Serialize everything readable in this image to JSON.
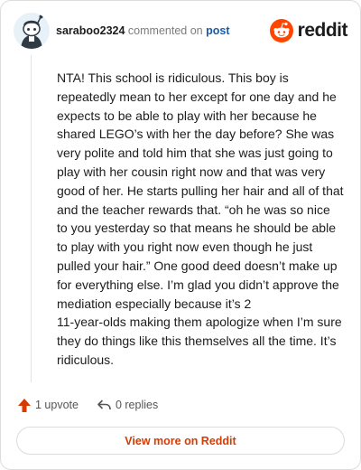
{
  "header": {
    "username": "saraboo2324",
    "action_text": "commented on",
    "post_link": "post",
    "brand_name": "reddit"
  },
  "comment": {
    "text": "NTA! This school is ridiculous. This boy is repeatedly mean to her except for one day and he expects to be able to play with her because he shared LEGO’s with her the day before? She was very polite and told him that she was just going to play with her cousin right now and that was very good of her. He starts pulling her hair and all of that and the teacher rewards that. “oh he was so nice to you yesterday so that means he should be able to play with you right now even though he just pulled your hair.” One good deed doesn’t make up for everything else. I’m glad you didn’t approve the mediation especially because it’s 2\n11-year-olds making them apologize when I’m sure they do things like this themselves all the time. It’s ridiculous."
  },
  "actions": {
    "upvote_label": "1 upvote",
    "reply_label": "0 replies"
  },
  "footer": {
    "view_more_label": "View more on Reddit"
  },
  "colors": {
    "brand_orange": "#ff4500",
    "upvote_orange": "#d93a00",
    "link_blue": "#1a5aa8"
  },
  "icons": {
    "avatar": "snoo-avatar-icon",
    "brand": "reddit-logo-icon",
    "upvote": "upvote-arrow-icon",
    "reply": "reply-arrow-icon"
  }
}
